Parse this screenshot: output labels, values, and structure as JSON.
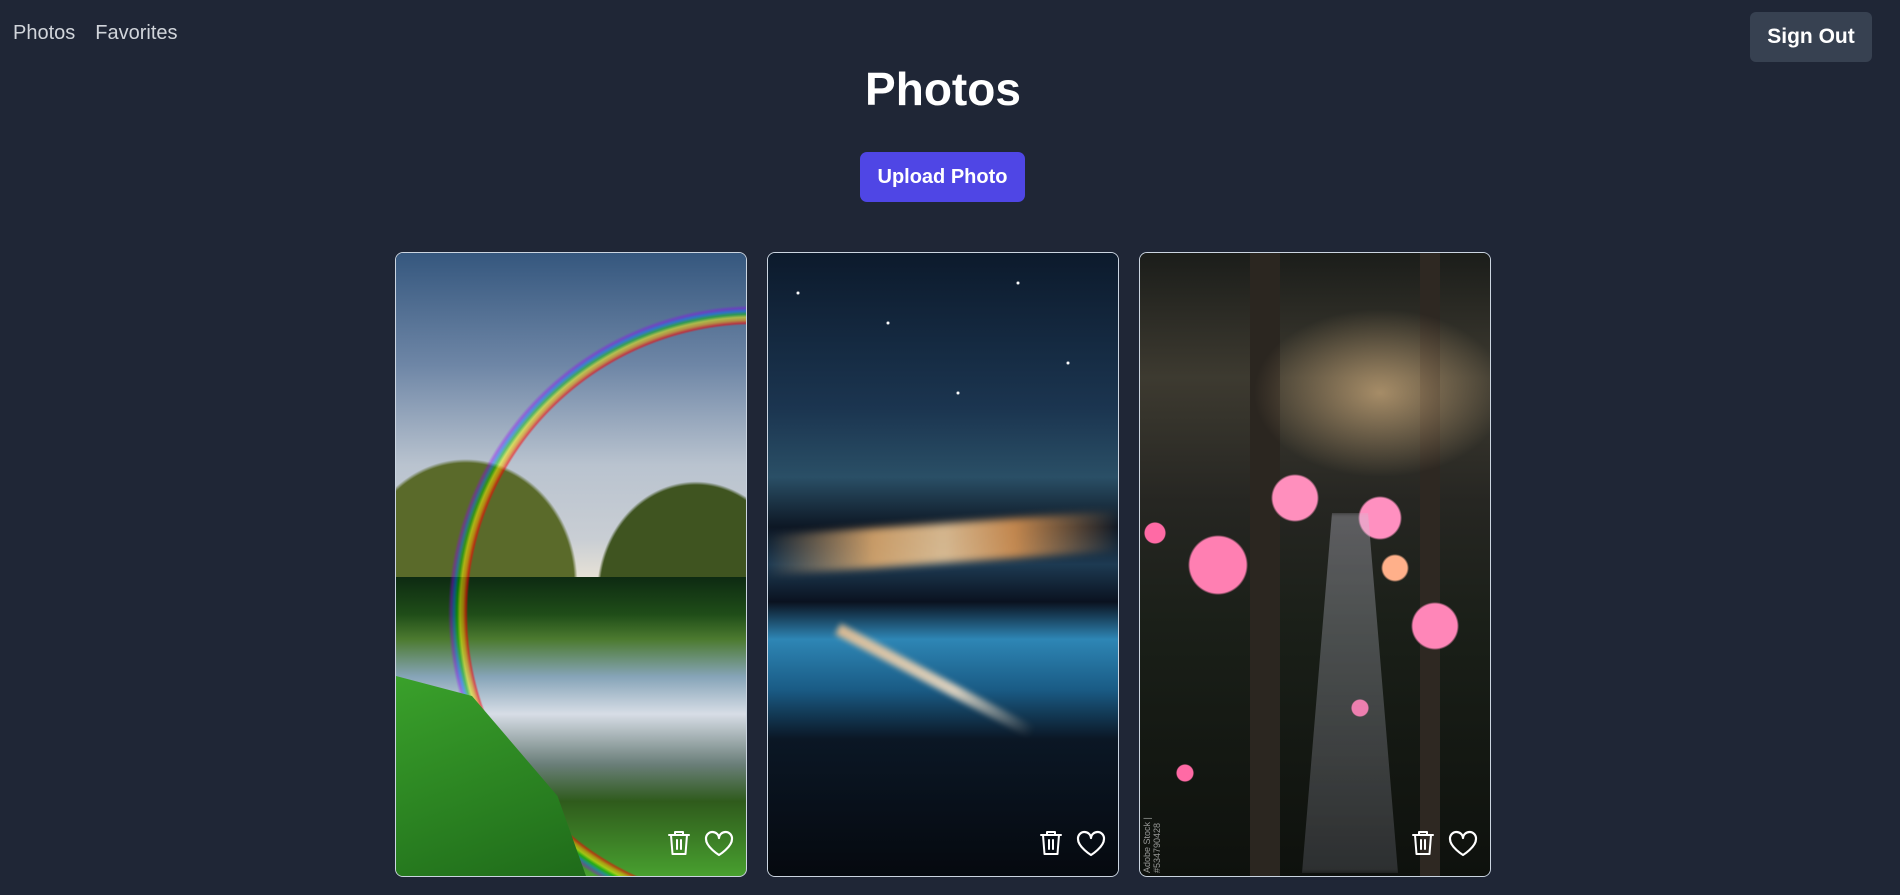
{
  "nav": {
    "items": [
      {
        "label": "Photos"
      },
      {
        "label": "Favorites"
      }
    ],
    "sign_out_label": "Sign Out"
  },
  "page": {
    "title": "Photos",
    "upload_label": "Upload Photo"
  },
  "photos": [
    {
      "subject": "rainbow over river",
      "favorited": false,
      "icons": [
        "trash-icon",
        "heart-icon"
      ]
    },
    {
      "subject": "misty mountains at night",
      "favorited": false,
      "icons": [
        "trash-icon",
        "heart-icon"
      ]
    },
    {
      "subject": "pink flowers on forest path",
      "favorited": false,
      "icons": [
        "trash-icon",
        "heart-icon"
      ],
      "watermark": "Adobe Stock | #534790428"
    }
  ],
  "colors": {
    "background": "#1f2636",
    "primary": "#4f46e5",
    "secondary_button": "#374151",
    "card_border": "#cbd5e1"
  }
}
